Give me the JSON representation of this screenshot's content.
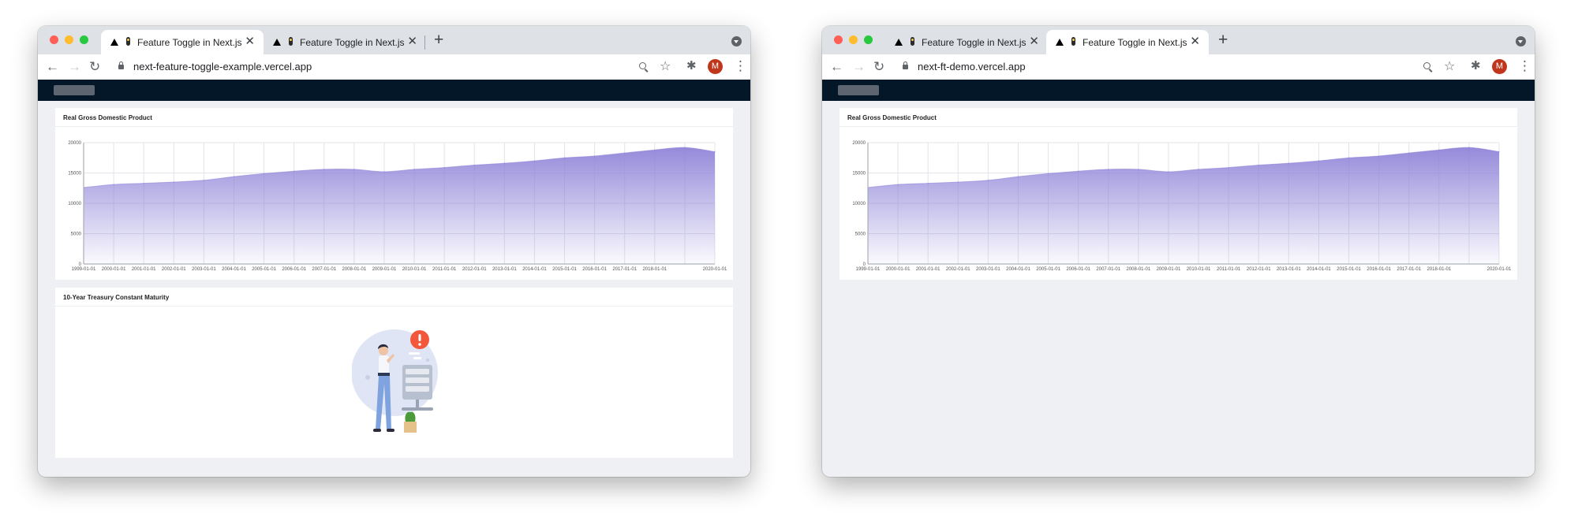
{
  "browsers": [
    {
      "tabs": [
        {
          "title": "Feature Toggle in Next.js",
          "close": "✕"
        },
        {
          "title": "Feature Toggle in Next.js",
          "close": "✕"
        }
      ],
      "new_tab_label": "+",
      "url": "next-feature-toggle-example.vercel.app",
      "avatar_letter": "M",
      "cards": [
        {
          "title": "Real Gross Domestic Product"
        },
        {
          "title": "10-Year Treasury Constant Maturity"
        }
      ]
    },
    {
      "tabs": [
        {
          "title": "Feature Toggle in Next.js",
          "close": "✕"
        },
        {
          "title": "Feature Toggle in Next.js",
          "close": "✕"
        }
      ],
      "new_tab_label": "+",
      "url": "next-ft-demo.vercel.app",
      "avatar_letter": "M",
      "cards": [
        {
          "title": "Real Gross Domestic Product"
        }
      ]
    }
  ],
  "icons": {
    "back": "arrow-left-icon",
    "forward": "arrow-right-icon",
    "reload": "reload-icon",
    "lock": "lock-icon",
    "zoom": "zoom-icon",
    "star": "star-icon",
    "extensions": "puzzle-icon",
    "menu": "kebab-icon"
  },
  "colors": {
    "navbar": "#041728",
    "area_fill": "#8f84d8",
    "alert": "#f2573b"
  },
  "chart_data": {
    "type": "area",
    "x": [
      "1999-01-01",
      "2000-01-01",
      "2001-01-01",
      "2002-01-01",
      "2003-01-01",
      "2004-01-01",
      "2005-01-01",
      "2006-01-01",
      "2007-01-01",
      "2008-01-01",
      "2009-01-01",
      "2010-01-01",
      "2011-01-01",
      "2012-01-01",
      "2013-01-01",
      "2014-01-01",
      "2015-01-01",
      "2016-01-01",
      "2017-01-01",
      "2018-01-01",
      "2019-01-01",
      "2020-01-01"
    ],
    "values": [
      12600,
      13100,
      13300,
      13500,
      13800,
      14400,
      14900,
      15300,
      15600,
      15600,
      15200,
      15600,
      15900,
      16300,
      16600,
      17000,
      17500,
      17800,
      18300,
      18800,
      19200,
      18500
    ],
    "x_tick_labels": [
      "1999-01-01",
      "2000-01-01",
      "2001-01-01",
      "2002-01-01",
      "2003-01-01",
      "2004-01-01",
      "2005-01-01",
      "2006-01-01",
      "2007-01-01",
      "2008-01-01",
      "2009-01-01",
      "2010-01-01",
      "2011-01-01",
      "2012-01-01",
      "2013-01-01",
      "2014-01-01",
      "2015-01-01",
      "2016-01-01",
      "2017-01-01",
      "2018-01-01",
      "",
      "2020-01-01"
    ],
    "y_ticks": [
      "0",
      "5000",
      "10000",
      "15000",
      "20000"
    ],
    "ylim": [
      0,
      20000
    ],
    "grid": true,
    "fill": "gradient-purple"
  }
}
